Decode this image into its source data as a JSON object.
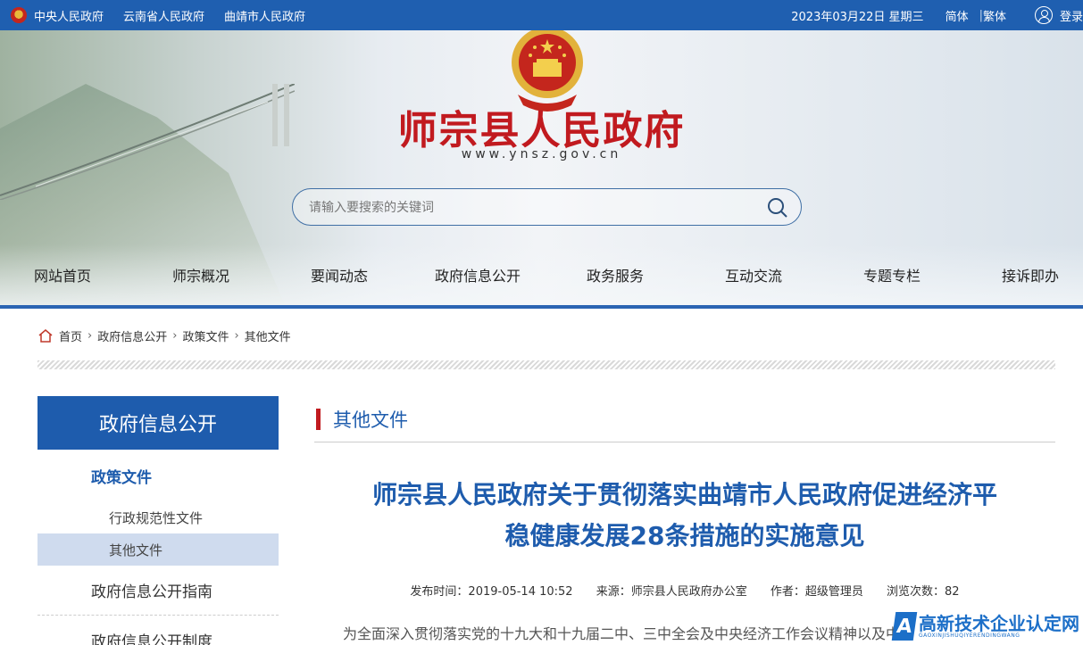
{
  "topbar": {
    "links": [
      "中央人民政府",
      "云南省人民政府",
      "曲靖市人民政府"
    ],
    "date": "2023年03月22日 星期三",
    "lang_simplified": "简体",
    "lang_separator": "|",
    "lang_traditional": "繁体",
    "login": "登录"
  },
  "header": {
    "site_title": "师宗县人民政府",
    "site_url": "www.ynsz.gov.cn",
    "search_placeholder": "请输入要搜索的关键词"
  },
  "nav": [
    "网站首页",
    "师宗概况",
    "要闻动态",
    "政府信息公开",
    "政务服务",
    "互动交流",
    "专题专栏",
    "接诉即办"
  ],
  "breadcrumb": [
    "首页",
    "政府信息公开",
    "政策文件",
    "其他文件"
  ],
  "sidebar": {
    "heading": "政府信息公开",
    "category": "政策文件",
    "sub_items": [
      "行政规范性文件",
      "其他文件"
    ],
    "active_sub": "其他文件",
    "items": [
      "政府信息公开指南",
      "政府信息公开制度"
    ]
  },
  "main": {
    "section_title": "其他文件",
    "article_title_line1": "师宗县人民政府关于贯彻落实曲靖市人民政府促进经济平",
    "article_title_line2": "稳健康发展28条措施的实施意见",
    "meta": {
      "published": "发布时间：2019-05-14 10:52",
      "source": "来源：师宗县人民政府办公室",
      "author": "作者：超级管理员",
      "views": "浏览次数：82"
    },
    "body_first_line": "为全面深入贯彻落实党的十九大和十九届二中、三中全会及中央经济工作会议精神以及中"
  },
  "watermark": {
    "logo_letter": "A",
    "title": "高新技术企业认定网",
    "subtitle": "GAOXINJISHUQIYERENDINGWANG"
  },
  "colors": {
    "topbar": "#1f5fb0",
    "title_red": "#c11a1f",
    "accent_blue": "#1e5cad",
    "active_bg": "#cfdbee"
  }
}
